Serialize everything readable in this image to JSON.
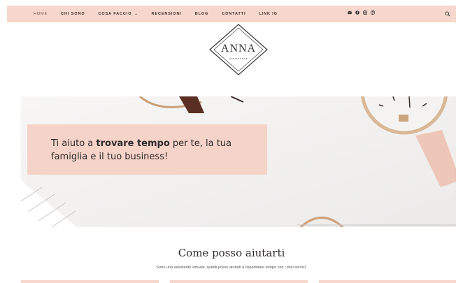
{
  "nav": {
    "items": [
      {
        "label": "HOME"
      },
      {
        "label": "CHI SONO"
      },
      {
        "label": "COSA FACCIO"
      },
      {
        "label": "RECENSIONI"
      },
      {
        "label": "BLOG"
      },
      {
        "label": "CONTATTI"
      },
      {
        "label": "LINK IG"
      }
    ],
    "dropdown_caret": "⌄",
    "social_icons": [
      "email-icon",
      "facebook-icon",
      "instagram-icon",
      "pinterest-icon"
    ],
    "search_icon": "search-icon"
  },
  "logo": {
    "name": "ANNA",
    "tagline": "ASSISTANTE"
  },
  "hero": {
    "text_before": "Ti aiuto a ",
    "text_bold": "trovare tempo",
    "text_after": " per te, la tua famiglia e il tuo business!"
  },
  "services": {
    "title": "Come posso aiutarti",
    "subtitle": "Sono una assistente virtuale, quindi posso aiutarti a risparmiare tempo con i miei servizi."
  },
  "colors": {
    "accent_pink": "#f6d7cd",
    "hero_box": "#f6d3c8",
    "text_dark": "#2d2a2a"
  }
}
